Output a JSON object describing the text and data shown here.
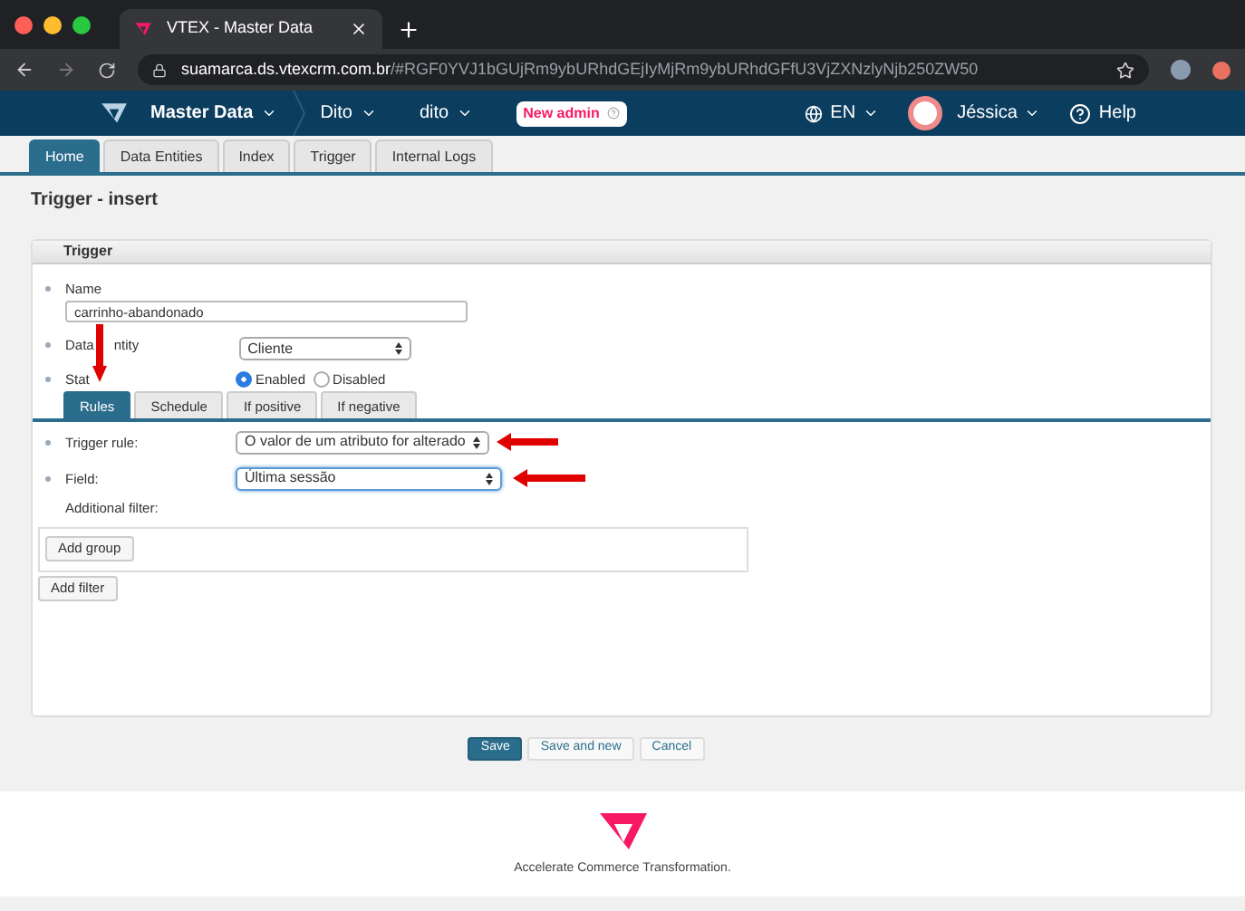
{
  "browser": {
    "tab_title": "VTEX - Master Data",
    "url_host": "suamarca.ds.vtexcrm.com.br",
    "url_path": "/#RGF0YVJ1bGUjRm9ybURhdGEjIyMjRm9ybURhdGFfU3VjZXNzlyNjb250ZW50"
  },
  "topbar": {
    "app": "Master Data",
    "crumbs": [
      "Dito",
      "dito"
    ],
    "badge": "New admin",
    "language": "EN",
    "user": "Jéssica",
    "help": "Help"
  },
  "nav_tabs": [
    {
      "label": "Home",
      "selected": true
    },
    {
      "label": "Data Entities",
      "selected": false
    },
    {
      "label": "Index",
      "selected": false
    },
    {
      "label": "Trigger",
      "selected": false
    },
    {
      "label": "Internal Logs",
      "selected": false
    }
  ],
  "page_title": "Trigger - insert",
  "panel": {
    "title": "Trigger",
    "name_label": "Name",
    "name_value": "carrinho-abandonado",
    "entity_label_parts": [
      "Data",
      "ntity"
    ],
    "entity_value": "Cliente",
    "status_label": "Stat",
    "status_options": [
      {
        "label": "Enabled",
        "selected": true
      },
      {
        "label": "Disabled",
        "selected": false
      }
    ],
    "tabs": [
      {
        "label": "Rules",
        "selected": true
      },
      {
        "label": "Schedule",
        "selected": false
      },
      {
        "label": "If positive",
        "selected": false
      },
      {
        "label": "If negative",
        "selected": false
      }
    ],
    "trigger_rule_label": "Trigger rule:",
    "trigger_rule_value": "O valor de um atributo for alterado",
    "field_label": "Field:",
    "field_value": "Última sessão",
    "additional_filter_label": "Additional filter:",
    "add_group": "Add group",
    "add_filter": "Add filter"
  },
  "actions": [
    {
      "label": "Save",
      "kind": "primary"
    },
    {
      "label": "Save and new",
      "kind": "secondary"
    },
    {
      "label": "Cancel",
      "kind": "secondary"
    }
  ],
  "footer": {
    "tagline": "Accelerate Commerce Transformation."
  }
}
